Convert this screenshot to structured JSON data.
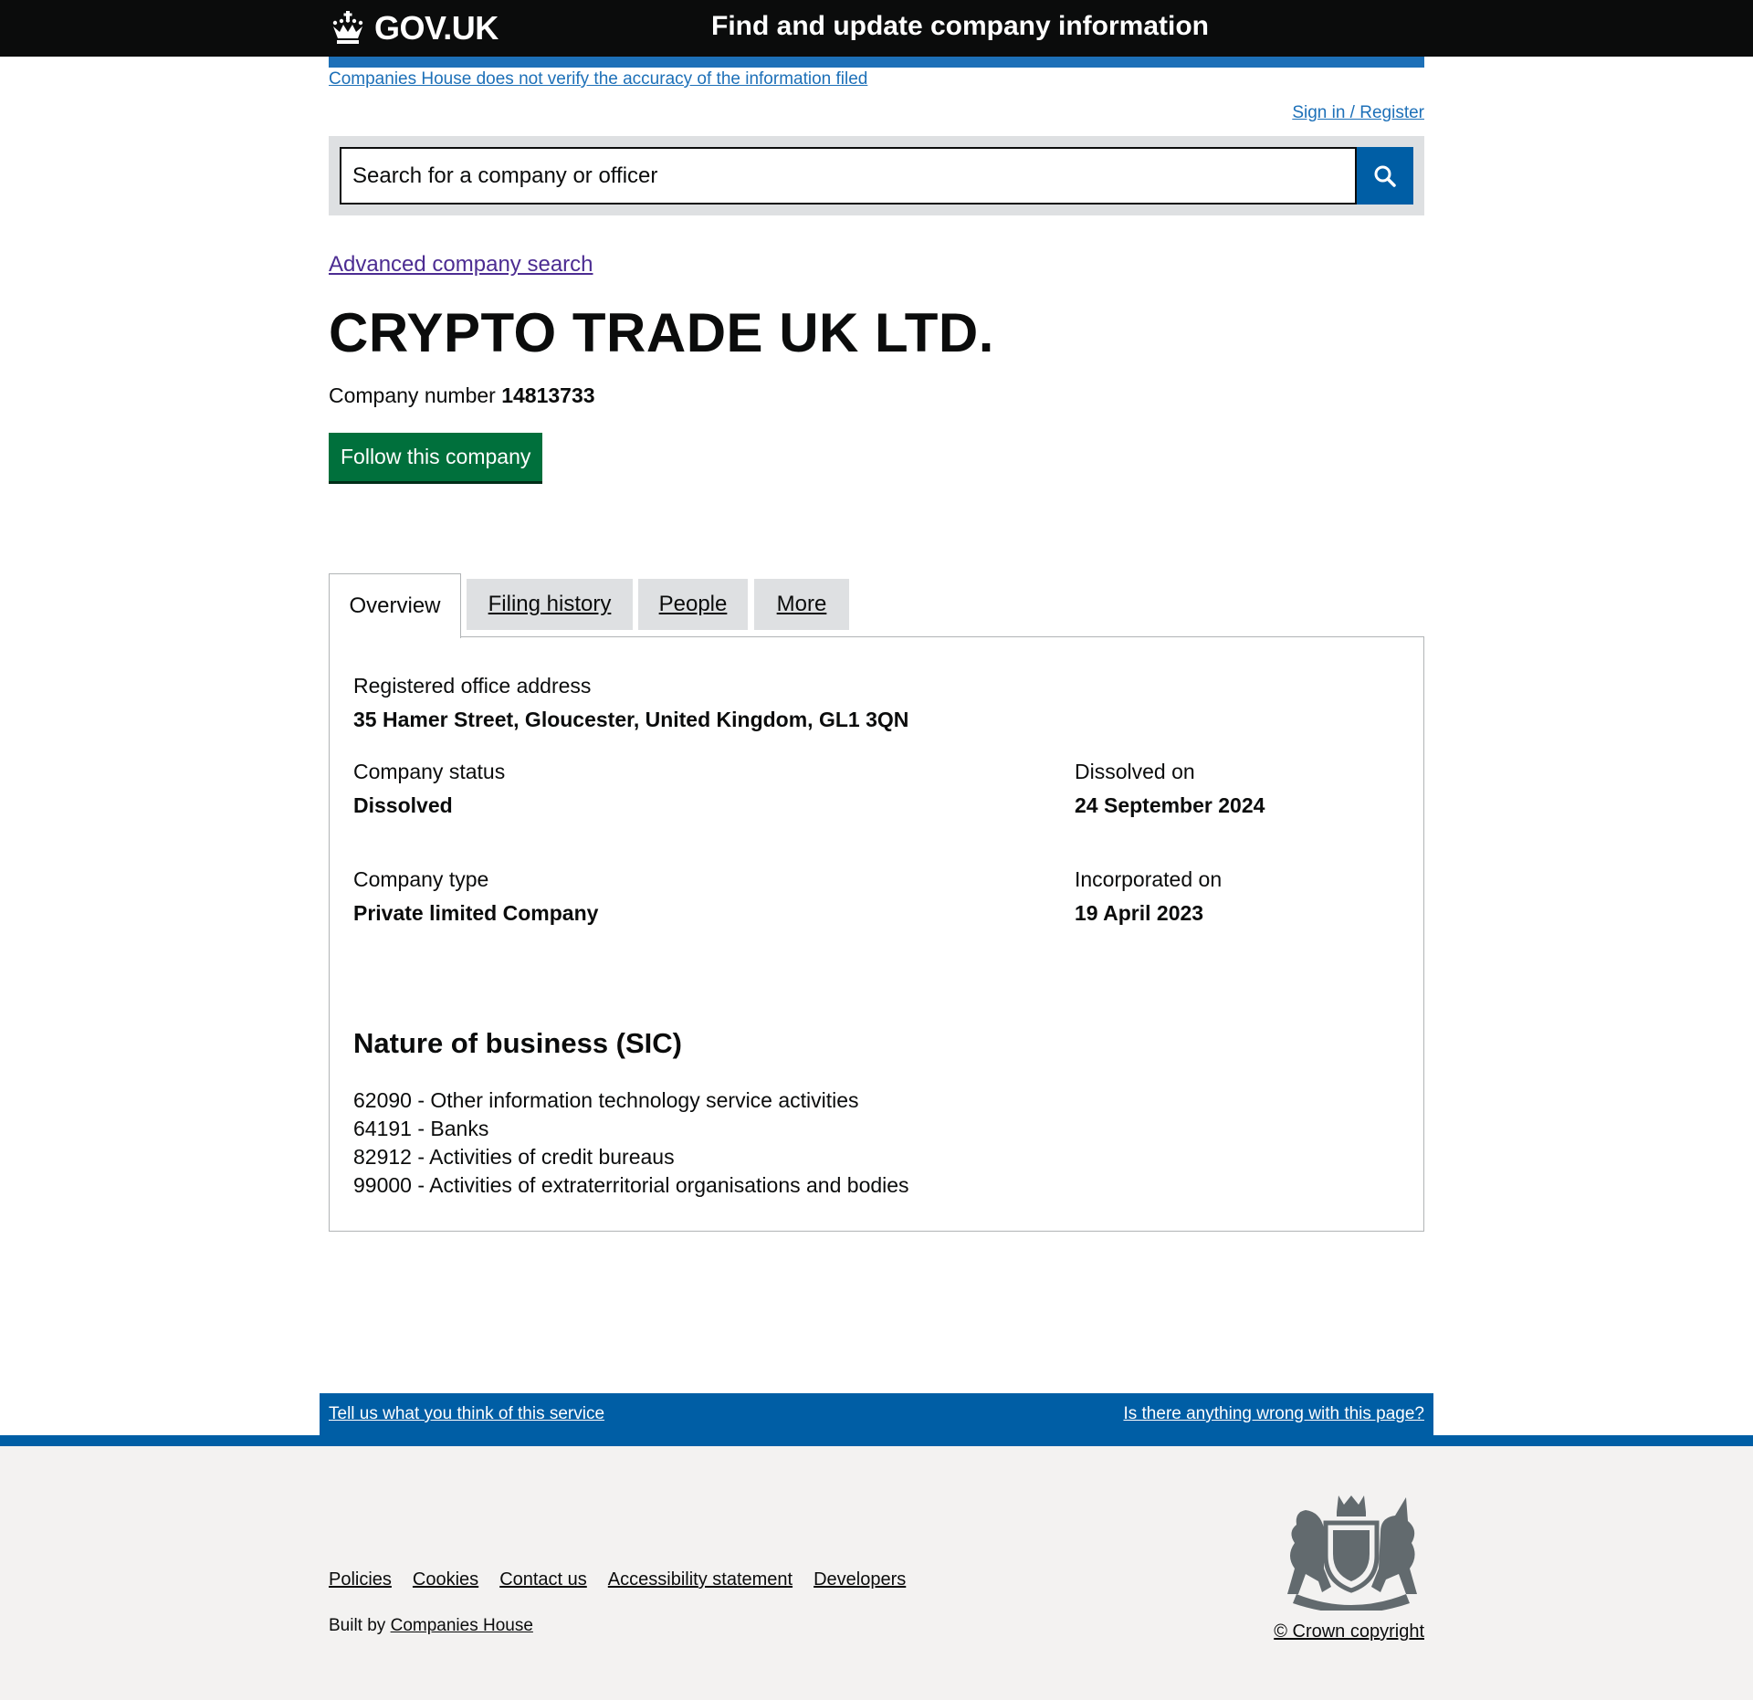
{
  "header": {
    "logo_text": "GOV.UK",
    "service_name": "Find and update company information"
  },
  "disclaimer": "Companies House does not verify the accuracy of the information filed",
  "signin": "Sign in / Register",
  "search": {
    "placeholder": "Search for a company or officer",
    "value": ""
  },
  "advanced_search": "Advanced company search",
  "company": {
    "name": "CRYPTO TRADE UK LTD.",
    "number_label": "Company number",
    "number": "14813733",
    "follow_label": "Follow this company"
  },
  "tabs": [
    {
      "label": "Overview",
      "active": true
    },
    {
      "label": "Filing history",
      "active": false
    },
    {
      "label": "People",
      "active": false
    },
    {
      "label": "More",
      "active": false
    }
  ],
  "overview": {
    "address_label": "Registered office address",
    "address": "35 Hamer Street, Gloucester, United Kingdom, GL1 3QN",
    "status_label": "Company status",
    "status": "Dissolved",
    "dissolved_label": "Dissolved on",
    "dissolved": "24 September 2024",
    "type_label": "Company type",
    "type": "Private limited Company",
    "incorporated_label": "Incorporated on",
    "incorporated": "19 April 2023",
    "sic_heading": "Nature of business (SIC)",
    "sic": [
      "62090 - Other information technology service activities",
      "64191 - Banks",
      "82912 - Activities of credit bureaus",
      "99000 - Activities of extraterritorial organisations and bodies"
    ]
  },
  "feedback": {
    "left": "Tell us what you think of this service",
    "right": "Is there anything wrong with this page?"
  },
  "footer": {
    "links": [
      "Policies",
      "Cookies",
      "Contact us",
      "Accessibility statement",
      "Developers"
    ],
    "built_by_prefix": "Built by",
    "built_by_link": "Companies House",
    "copyright": "© Crown copyright"
  },
  "colors": {
    "header_bg": "#0b0c0c",
    "link": "#1d70b8",
    "visited_link": "#4c2c92",
    "search_button": "#005ea5",
    "follow_button": "#00703c",
    "footer_bg": "#f3f2f1"
  }
}
